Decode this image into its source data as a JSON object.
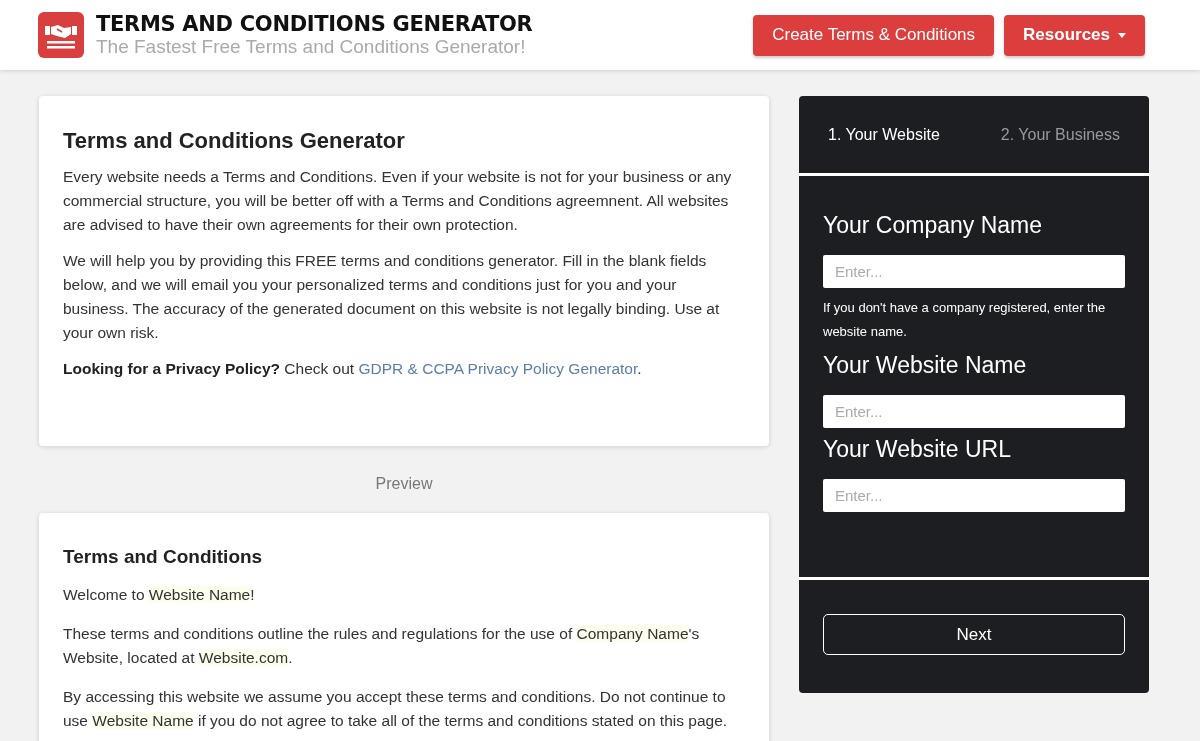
{
  "header": {
    "title": "TERMS AND CONDITIONS GENERATOR",
    "tagline": "The Fastest Free Terms and Conditions Generator!",
    "buttons": [
      {
        "label": "Create Terms & Conditions",
        "kind": "plain"
      },
      {
        "label": "Resources",
        "kind": "dropdown"
      }
    ]
  },
  "intro": {
    "heading": "Terms and Conditions Generator",
    "paragraphs": [
      "Every website needs a Terms and Conditions. Even if your website is not for your business or any commercial structure, you will be better off with a Terms and Conditions agreemnent. All websites are advised to have their own agreements for their own protection.",
      "We will help you by providing this FREE terms and conditions generator. Fill in the blank fields below, and we will email you your personalized terms and conditions just for you and your business. The accuracy of the generated document on this website is not legally binding. Use at your own risk."
    ],
    "privacy": {
      "text": "**Looking for a Privacy Policy?** Check out ",
      "link": "GDPR & CCPA Privacy Policy Generator",
      "after": "."
    }
  },
  "preview_label": "Preview",
  "preview": {
    "heading": "Terms and Conditions",
    "paragraphs": [
      [
        {
          "text": "Welcome to ",
          "highlight": false
        },
        {
          "text": "Website Name",
          "highlight": true
        },
        {
          "text": "!",
          "highlight": false
        }
      ],
      [
        {
          "text": "These terms and conditions outline the rules and regulations for the use of ",
          "highlight": false
        },
        {
          "text": "Company Name",
          "highlight": true
        },
        {
          "text": "'s Website, located at ",
          "highlight": false
        },
        {
          "text": "Website.com",
          "highlight": true
        },
        {
          "text": ".",
          "highlight": false
        }
      ],
      [
        {
          "text": "By accessing this website we assume you accept these terms and conditions. Do not continue to use ",
          "highlight": false
        },
        {
          "text": "Website Name",
          "highlight": true
        },
        {
          "text": " if you do not agree to take all of the terms and conditions stated on this page.",
          "highlight": false
        }
      ]
    ]
  },
  "wizard": {
    "steps": [
      {
        "label": "1. Your Website",
        "selected": true
      },
      {
        "label": "2. Your Business",
        "selected": false
      }
    ],
    "fields": [
      {
        "label": "Your Company Name",
        "placeholder": "Enter...",
        "help": "If you don't have a company registered, enter the website name."
      },
      {
        "label": "Your Website Name",
        "placeholder": "Enter..."
      },
      {
        "label": "Your Website URL",
        "placeholder": "Enter..."
      }
    ],
    "next": "Next"
  }
}
